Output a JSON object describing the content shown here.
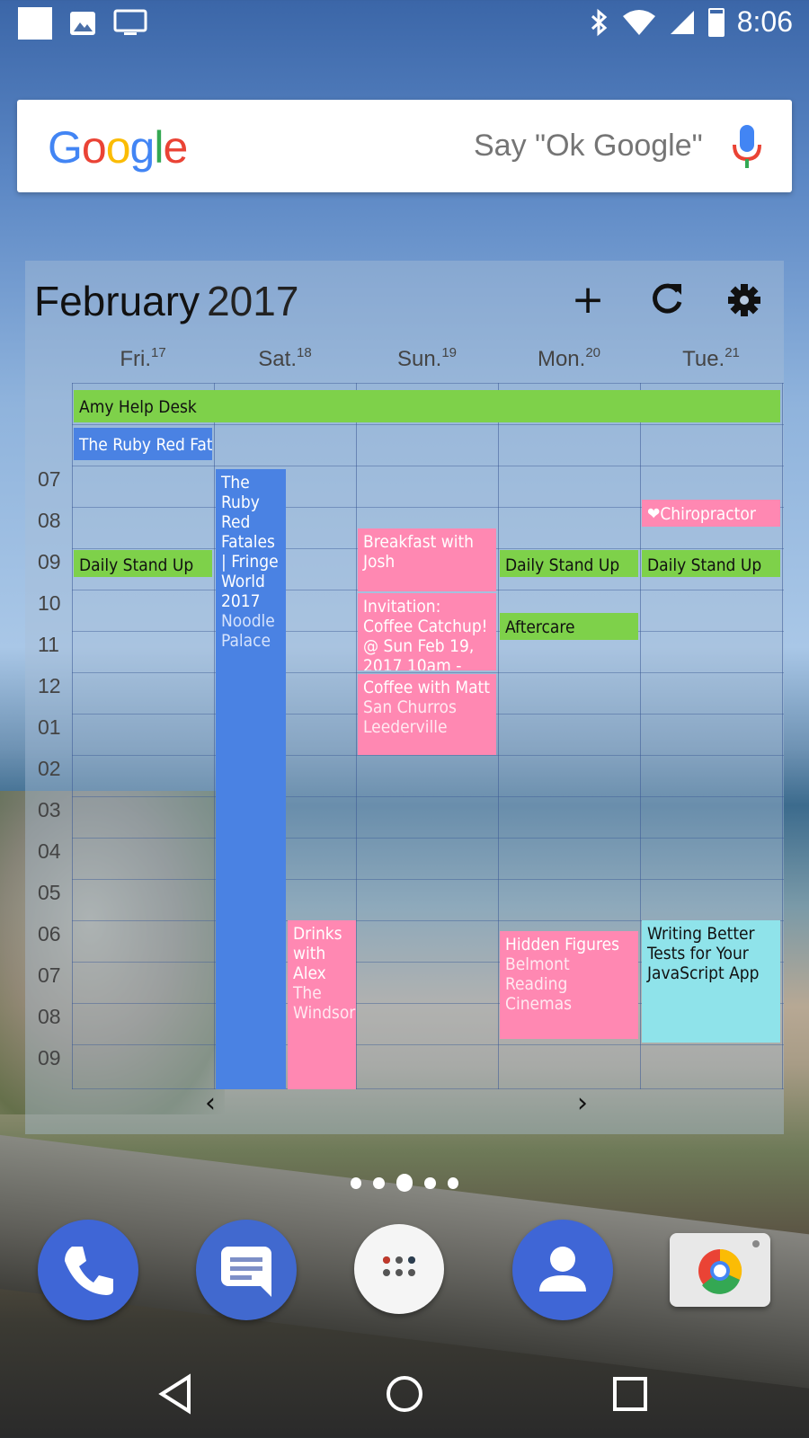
{
  "status_bar": {
    "time": "8:06",
    "icons": [
      "notification-square-icon",
      "image-icon",
      "cast-icon",
      "bluetooth-icon",
      "wifi-icon",
      "signal-icon",
      "battery-icon"
    ]
  },
  "google_search": {
    "logo": "Google",
    "hint": "Say \"Ok Google\"",
    "mic_icon": "mic-icon"
  },
  "calendar": {
    "month": "February",
    "year": "2017",
    "buttons": {
      "add": "+",
      "refresh": "⟳",
      "settings": "⚙"
    },
    "days": [
      {
        "name": "Fri.",
        "num": "17"
      },
      {
        "name": "Sat.",
        "num": "18"
      },
      {
        "name": "Sun.",
        "num": "19"
      },
      {
        "name": "Mon.",
        "num": "20"
      },
      {
        "name": "Tue.",
        "num": "21"
      }
    ],
    "hours": [
      "07",
      "08",
      "09",
      "10",
      "11",
      "12",
      "01",
      "02",
      "03",
      "04",
      "05",
      "06",
      "07",
      "08",
      "09"
    ],
    "events": {
      "amy": "Amy Help Desk",
      "ruby_fri": "The Ruby Red Fatales",
      "ruby_sat_title": "The Ruby Red Fatales | Fringe World 2017",
      "ruby_sat_loc": "Noodle Palace",
      "standup": "Daily Stand Up",
      "breakfast": "Breakfast with Josh",
      "invitation": "Invitation: Coffee Catchup! @ Sun Feb 19, 2017 10am -",
      "coffee_title": "Coffee with Matt",
      "coffee_loc": "San Churros Leederville",
      "aftercare": "Aftercare",
      "chiro": "Chiropractor",
      "drinks_title": "Drinks with Alex",
      "drinks_loc": "The Windsor",
      "hidden_title": "Hidden Figures",
      "hidden_loc": "Belmont Reading Cinemas",
      "writing": "Writing Better Tests for Your JavaScript App"
    },
    "nav": {
      "prev": "‹",
      "next": "›"
    }
  },
  "colors": {
    "green": "#7ed14a",
    "blue": "#4a82e3",
    "pink": "#ff88b2",
    "cyan": "#8fe3ea"
  },
  "home": {
    "page_count": 5,
    "active_page": 3,
    "dock": [
      "phone-icon",
      "messages-icon",
      "app-drawer-icon",
      "contacts-icon",
      "camera-icon"
    ]
  },
  "navbar": [
    "back-icon",
    "home-icon",
    "recents-icon"
  ]
}
